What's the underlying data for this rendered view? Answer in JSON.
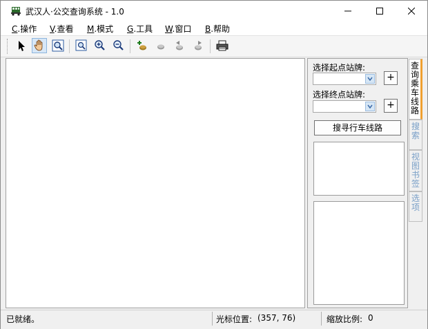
{
  "window": {
    "title": "武汉人·公交查询系统 - 1.0",
    "min_glyph": "—",
    "max_glyph": "☐",
    "close_glyph": "✕"
  },
  "menu": [
    {
      "key": "C",
      "label": ".操作"
    },
    {
      "key": "V",
      "label": ".查看"
    },
    {
      "key": "M",
      "label": ".模式"
    },
    {
      "key": "G",
      "label": ".工具"
    },
    {
      "key": "W",
      "label": ".窗口"
    },
    {
      "key": "B",
      "label": ".帮助"
    }
  ],
  "toolbar": {
    "icons": [
      "pointer-icon",
      "hand-pan-icon",
      "magnifier-icon",
      "zoom-window-icon",
      "zoom-in-icon",
      "zoom-out-icon",
      "add-station-icon",
      "route-icon",
      "route-back-icon",
      "route-forward-icon",
      "print-icon"
    ]
  },
  "panel": {
    "start_label": "选择起点站牌:",
    "end_label": "选择终点站牌:",
    "add_label": "+",
    "search_label": "搜寻行车线路"
  },
  "tabs": [
    {
      "label": "查询乘车线路",
      "active": true
    },
    {
      "label": "搜索",
      "active": false
    },
    {
      "label": "视图书签",
      "active": false
    },
    {
      "label": "选项",
      "active": false
    }
  ],
  "status": {
    "ready": "已就绪。",
    "cursor_label": "光标位置:",
    "cursor_value": "(357, 76)",
    "scale_label": "缩放比例:",
    "scale_value": "0"
  },
  "colors": {
    "accent_tab": "#f0a030",
    "inactive_tab_text": "#7aa0c8"
  }
}
